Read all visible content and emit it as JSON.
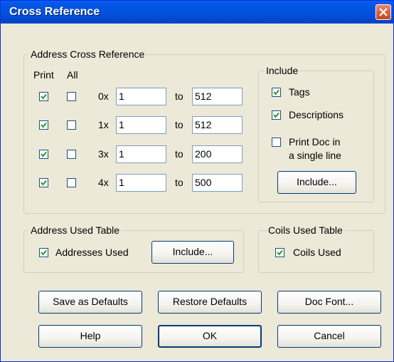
{
  "window": {
    "title": "Cross Reference"
  },
  "address_group": {
    "title": "Address Cross Reference",
    "print_header": "Print",
    "all_header": "All",
    "to_label": "to",
    "rows": [
      {
        "prefix": "0x",
        "print": true,
        "all": false,
        "from": "1",
        "to": "512"
      },
      {
        "prefix": "1x",
        "print": true,
        "all": false,
        "from": "1",
        "to": "512"
      },
      {
        "prefix": "3x",
        "print": true,
        "all": false,
        "from": "1",
        "to": "200"
      },
      {
        "prefix": "4x",
        "print": true,
        "all": false,
        "from": "1",
        "to": "500"
      }
    ]
  },
  "include_group": {
    "title": "Include",
    "tags_label": "Tags",
    "tags_checked": true,
    "descriptions_label": "Descriptions",
    "descriptions_checked": true,
    "print_doc_label_1": "Print Doc in",
    "print_doc_label_2": "a single line",
    "print_doc_checked": false,
    "include_button": "Include..."
  },
  "address_used_group": {
    "title": "Address Used Table",
    "checkbox_label": "Addresses Used",
    "checked": true,
    "include_button": "Include..."
  },
  "coils_used_group": {
    "title": "Coils Used Table",
    "checkbox_label": "Coils Used",
    "checked": true
  },
  "buttons": {
    "save_defaults": "Save as Defaults",
    "restore_defaults": "Restore Defaults",
    "doc_font": "Doc Font...",
    "help": "Help",
    "ok": "OK",
    "cancel": "Cancel"
  },
  "colors": {
    "title_bar": "#0250da",
    "dialog_bg": "#ece9d8",
    "close_button": "#d2542c"
  }
}
